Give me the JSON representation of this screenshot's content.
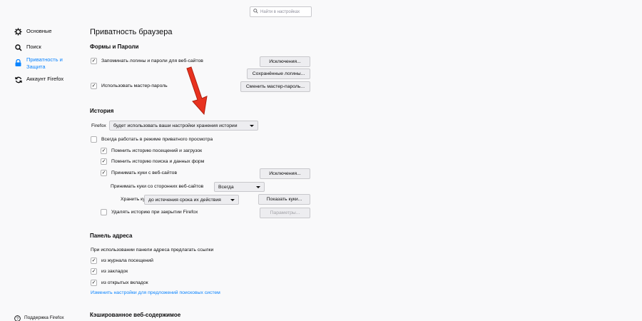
{
  "search": {
    "placeholder": "Найти в настройках"
  },
  "sidebar": {
    "items": [
      {
        "label": "Основные"
      },
      {
        "label": "Поиск"
      },
      {
        "label": "Приватность и Защита"
      },
      {
        "label": "Аккаунт Firefox"
      }
    ],
    "support": "Поддержка Firefox"
  },
  "page_title": "Приватность браузера",
  "forms": {
    "heading": "Формы и Пароли",
    "remember_logins": "Запоминать логины и пароли для веб-сайтов",
    "exceptions_button": "Исключения...",
    "saved_logins_button": "Сохранённые логины...",
    "master_password": "Использовать мастер-пароль",
    "change_master_button": "Сменить мастер-пароль..."
  },
  "history": {
    "heading": "История",
    "firefox_label": "Firefox",
    "mode_select": "будет использовать ваши настройки хранения истории",
    "private_mode": "Всегда работать в режиме приватного просмотра",
    "remember_visits": "Помнить историю посещений и загрузок",
    "remember_search": "Помнить историю поиска и данных форм",
    "accept_cookies": "Принимать куки с веб-сайтов",
    "cookie_exceptions_button": "Исключения...",
    "third_party_label": "Принимать куки со сторонних веб-сайтов",
    "third_party_select": "Всегда",
    "keep_label": "Хранить куки",
    "keep_select": "до истечения срока их действия",
    "show_cookies_button": "Показать куки...",
    "clear_on_close": "Удалять историю при закрытии Firefox",
    "settings_button": "Параметры..."
  },
  "address_bar": {
    "heading": "Панель адреса",
    "description": "При использовании панели адреса предлагать ссылки",
    "from_history": "из журнала посещений",
    "from_bookmarks": "из закладок",
    "from_tabs": "из открытых вкладок",
    "search_link": "Изменить настройки для предложений поисковых систем"
  },
  "cache": {
    "heading": "Кэшированное веб-содержимое"
  },
  "annotation": {
    "color": "#e8321f"
  }
}
